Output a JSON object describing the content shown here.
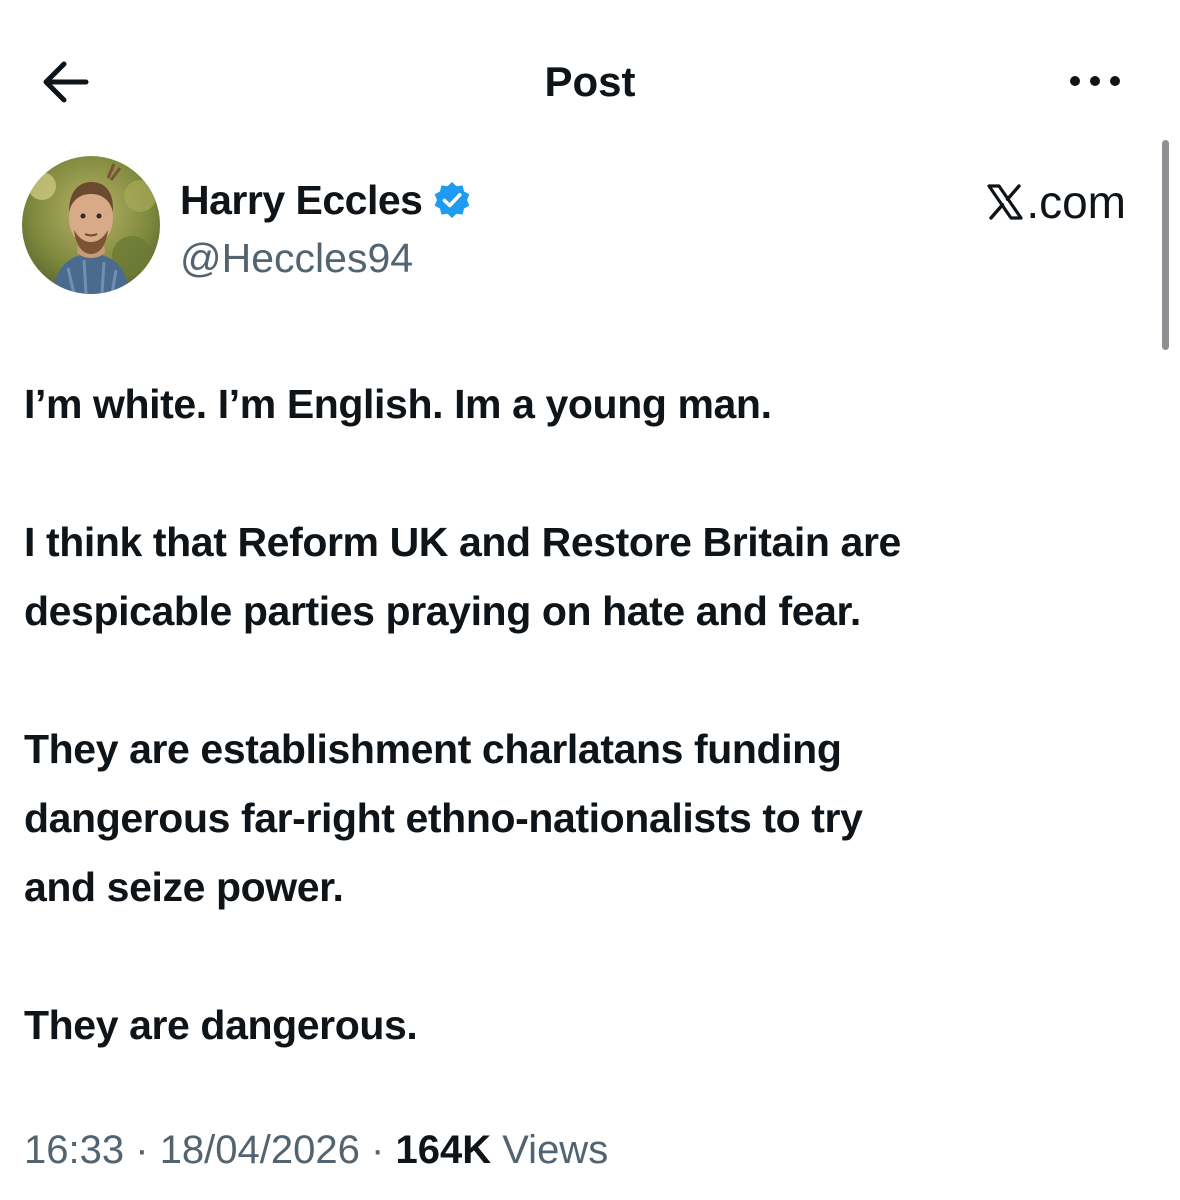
{
  "header": {
    "title": "Post",
    "back_icon": "arrow-left-icon",
    "more_icon": "more-horizontal-icon"
  },
  "author": {
    "display_name": "Harry Eccles",
    "handle": "@Heccles94",
    "verified_icon": "verified-badge-icon",
    "verified_color": "#1d9bf0"
  },
  "watermark": {
    "logo": "𝕏",
    "text": ".com"
  },
  "post": {
    "lines": [
      [
        "I’m white. I’m English. Im a young man."
      ],
      [
        "I think that Reform UK and Restore Britain are",
        "despicable parties praying on hate and fear."
      ],
      [
        "They are establishment charlatans funding",
        "dangerous far-right ethno-nationalists to try",
        "and seize power."
      ],
      [
        "They are dangerous."
      ]
    ]
  },
  "meta": {
    "time": "16:33",
    "date": "18/04/2026",
    "views_count": "164K",
    "views_label": "Views",
    "separator": "·"
  },
  "colors": {
    "text_primary": "#0f1419",
    "text_secondary": "#536471",
    "background": "#ffffff"
  }
}
